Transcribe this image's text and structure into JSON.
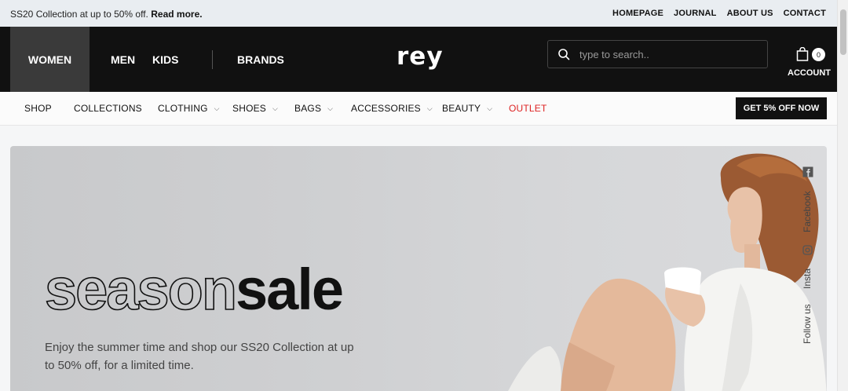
{
  "announcement": {
    "text": "SS20 Collection at up to 50% off.",
    "link": "Read more."
  },
  "top_nav": [
    "HOMEPAGE",
    "JOURNAL",
    "ABOUT US",
    "CONTACT"
  ],
  "gender_nav": {
    "women": "WOMEN",
    "men": "MEN",
    "kids": "KIDS",
    "brands": "BRANDS"
  },
  "logo": "rey",
  "search": {
    "placeholder": "type to search.."
  },
  "cart": {
    "count": "0"
  },
  "account": {
    "label": "ACCOUNT"
  },
  "categories": {
    "shop": "SHOP",
    "collections": "COLLECTIONS",
    "clothing": "CLOTHING",
    "shoes": "SHOES",
    "bags": "BAGS",
    "accessories": "ACCESSORIES",
    "beauty": "BEAUTY",
    "outlet": "OUTLET"
  },
  "promo_button": "GET 5% OFF NOW",
  "hero": {
    "headline_outline": "season",
    "headline_solid": "sale",
    "subtext": "Enjoy the summer time and shop our SS20 Collection at up to 50% off, for a limited time."
  },
  "social": {
    "facebook": "Facebook",
    "insta": "Insta",
    "follow": "Follow us"
  },
  "colors": {
    "header_bg": "#111111",
    "active_tab": "#3a3a3a",
    "outlet": "#dd2222",
    "hero_bg": "#cfd0d2"
  },
  "icons": [
    "search-icon",
    "shopping-bag-icon",
    "chevron-down-icon",
    "facebook-icon",
    "instagram-icon"
  ]
}
